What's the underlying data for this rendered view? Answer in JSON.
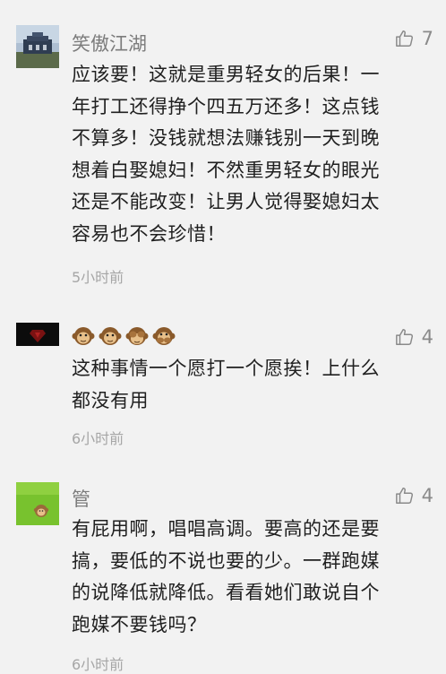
{
  "comments": [
    {
      "username": "笑傲江湖",
      "likes": "7",
      "lines": [
        "应该要！这就是重男轻女的后果！一",
        "年打工还得挣个四五万还多！这点钱",
        "不算多！没钱就想法赚钱别一天到晚",
        "想着白娶媳妇！不然重男轻女的眼光",
        "还是不能改变！让男人觉得娶媳妇太",
        "容易也不会珍惜！"
      ],
      "time": "5小时前"
    },
    {
      "username_emoji": [
        "🐵",
        "🐵",
        "🙈",
        "🙊"
      ],
      "likes": "4",
      "lines": [
        "这种事情一个愿打一个愿挨！上什么",
        "都没有用"
      ],
      "time": "6小时前"
    },
    {
      "username": "管",
      "likes": "4",
      "lines": [
        "有屁用啊，唱唱高调。要高的还是要",
        "搞，要低的不说也要的少。一群跑媒",
        "的说降低就降低。看看她们敢说自个",
        "跑媒不要钱吗？"
      ],
      "time": "6小时前"
    }
  ]
}
